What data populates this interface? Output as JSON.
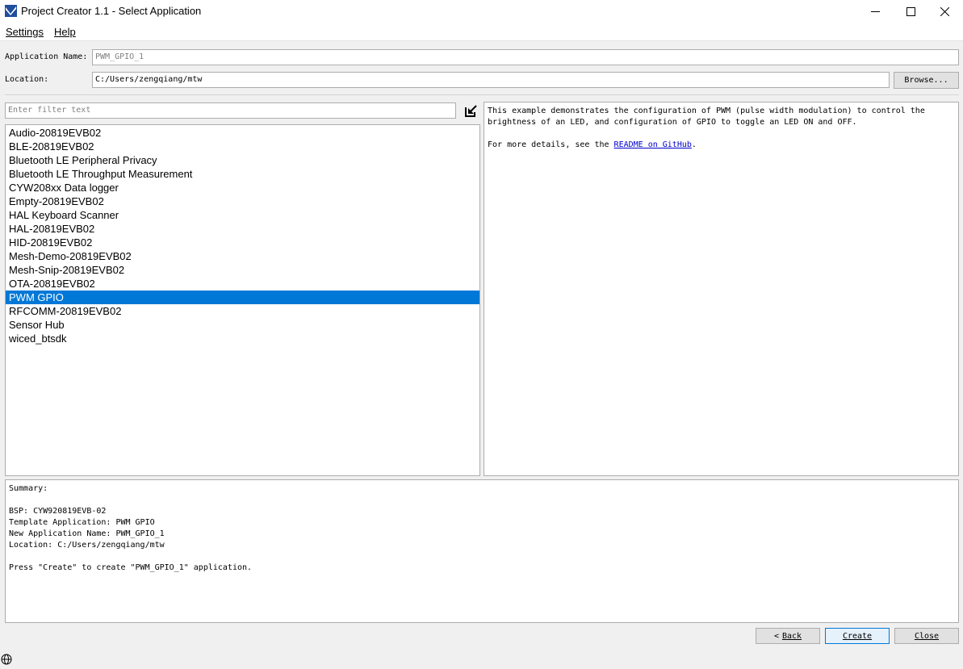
{
  "window": {
    "title": "Project Creator 1.1 - Select Application",
    "minimize_glyph": "—",
    "maximize_glyph": "☐",
    "close_glyph": "✕"
  },
  "menu": {
    "settings": "Settings",
    "help": "Help"
  },
  "form": {
    "app_name_label": "Application Name:",
    "app_name_value": "PWM_GPIO_1",
    "location_label": "Location:",
    "location_value": "C:/Users/zengqiang/mtw",
    "browse_label": "Browse..."
  },
  "filter": {
    "placeholder": "Enter filter text"
  },
  "app_list": {
    "selected": "PWM GPIO",
    "items": [
      "Audio-20819EVB02",
      "BLE-20819EVB02",
      "Bluetooth LE Peripheral Privacy",
      "Bluetooth LE Throughput Measurement",
      "CYW208xx Data logger",
      "Empty-20819EVB02",
      "HAL Keyboard Scanner",
      "HAL-20819EVB02",
      "HID-20819EVB02",
      "Mesh-Demo-20819EVB02",
      "Mesh-Snip-20819EVB02",
      "OTA-20819EVB02",
      "PWM GPIO",
      "RFCOMM-20819EVB02",
      "Sensor Hub",
      "wiced_btsdk"
    ]
  },
  "description": {
    "line1": "This example demonstrates the configuration of PWM (pulse width modulation) to control the",
    "line2": "brightness of an LED, and configuration of GPIO to toggle an LED ON and OFF.",
    "details_prefix": "For more details, see the ",
    "details_link": "README on GitHub",
    "details_suffix": "."
  },
  "summary": {
    "heading": "Summary:",
    "bsp": "BSP: CYW920819EVB-02",
    "template": "Template Application: PWM GPIO",
    "new_name": "New Application Name: PWM_GPIO_1",
    "location": "Location: C:/Users/zengqiang/mtw",
    "press": "Press \"Create\" to create \"PWM_GPIO_1\" application."
  },
  "buttons": {
    "back_arrow": "<",
    "back": "Back",
    "create": "Create",
    "close": "Close"
  },
  "colors": {
    "selection": "#0078d7",
    "link": "#0000cc"
  }
}
